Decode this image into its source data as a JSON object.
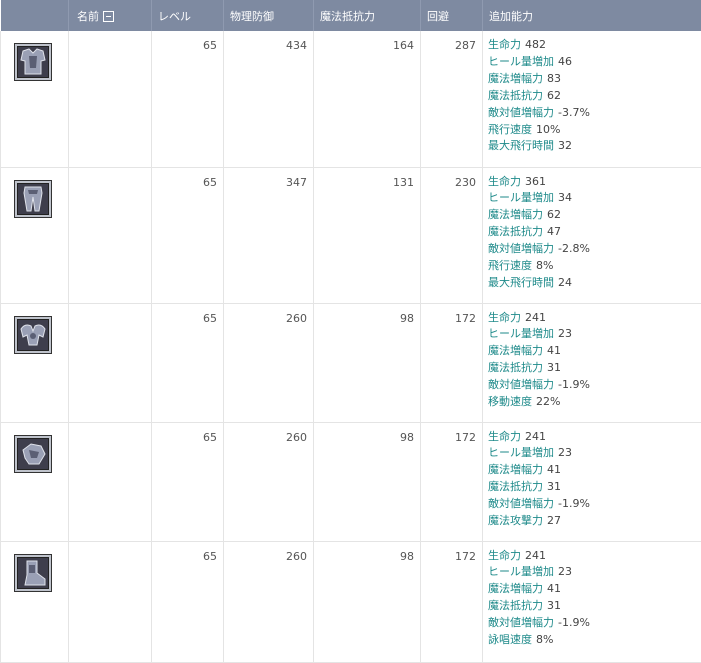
{
  "header": {
    "col_icon": "",
    "col_name": "名前",
    "col_level": "レベル",
    "col_phys_def": "物理防御",
    "col_mag_resist": "魔法抵抗力",
    "col_evasion": "回避",
    "col_extra": "追加能力"
  },
  "items": [
    {
      "icon": "chest-armor-icon",
      "name": "",
      "level": "65",
      "phys_def": "434",
      "mag_resist": "164",
      "evasion": "287",
      "attrs": [
        {
          "name": "生命力",
          "value": "482"
        },
        {
          "name": "ヒール量増加",
          "value": "46"
        },
        {
          "name": "魔法増幅力",
          "value": "83"
        },
        {
          "name": "魔法抵抗力",
          "value": "62"
        },
        {
          "name": "敵対値増幅力",
          "value": "-3.7%"
        },
        {
          "name": "飛行速度",
          "value": "10%"
        },
        {
          "name": "最大飛行時間",
          "value": "32"
        }
      ]
    },
    {
      "icon": "leg-armor-icon",
      "name": "",
      "level": "65",
      "phys_def": "347",
      "mag_resist": "131",
      "evasion": "230",
      "attrs": [
        {
          "name": "生命力",
          "value": "361"
        },
        {
          "name": "ヒール量増加",
          "value": "34"
        },
        {
          "name": "魔法増幅力",
          "value": "62"
        },
        {
          "name": "魔法抵抗力",
          "value": "47"
        },
        {
          "name": "敵対値増幅力",
          "value": "-2.8%"
        },
        {
          "name": "飛行速度",
          "value": "8%"
        },
        {
          "name": "最大飛行時間",
          "value": "24"
        }
      ]
    },
    {
      "icon": "shoulder-armor-icon",
      "name": "",
      "level": "65",
      "phys_def": "260",
      "mag_resist": "98",
      "evasion": "172",
      "attrs": [
        {
          "name": "生命力",
          "value": "241"
        },
        {
          "name": "ヒール量増加",
          "value": "23"
        },
        {
          "name": "魔法増幅力",
          "value": "41"
        },
        {
          "name": "魔法抵抗力",
          "value": "31"
        },
        {
          "name": "敵対値増幅力",
          "value": "-1.9%"
        },
        {
          "name": "移動速度",
          "value": "22%"
        }
      ]
    },
    {
      "icon": "glove-armor-icon",
      "name": "",
      "level": "65",
      "phys_def": "260",
      "mag_resist": "98",
      "evasion": "172",
      "attrs": [
        {
          "name": "生命力",
          "value": "241"
        },
        {
          "name": "ヒール量増加",
          "value": "23"
        },
        {
          "name": "魔法増幅力",
          "value": "41"
        },
        {
          "name": "魔法抵抗力",
          "value": "31"
        },
        {
          "name": "敵対値増幅力",
          "value": "-1.9%"
        },
        {
          "name": "魔法攻撃力",
          "value": "27"
        }
      ]
    },
    {
      "icon": "boot-armor-icon",
      "name": "",
      "level": "65",
      "phys_def": "260",
      "mag_resist": "98",
      "evasion": "172",
      "attrs": [
        {
          "name": "生命力",
          "value": "241"
        },
        {
          "name": "ヒール量増加",
          "value": "23"
        },
        {
          "name": "魔法増幅力",
          "value": "41"
        },
        {
          "name": "魔法抵抗力",
          "value": "31"
        },
        {
          "name": "敵対値増幅力",
          "value": "-1.9%"
        },
        {
          "name": "詠唱速度",
          "value": "8%"
        }
      ]
    }
  ],
  "colors": {
    "header_bg": "#7e8aa1",
    "attr_name": "#1e8a8a",
    "grid_line": "#e4e4e4"
  }
}
